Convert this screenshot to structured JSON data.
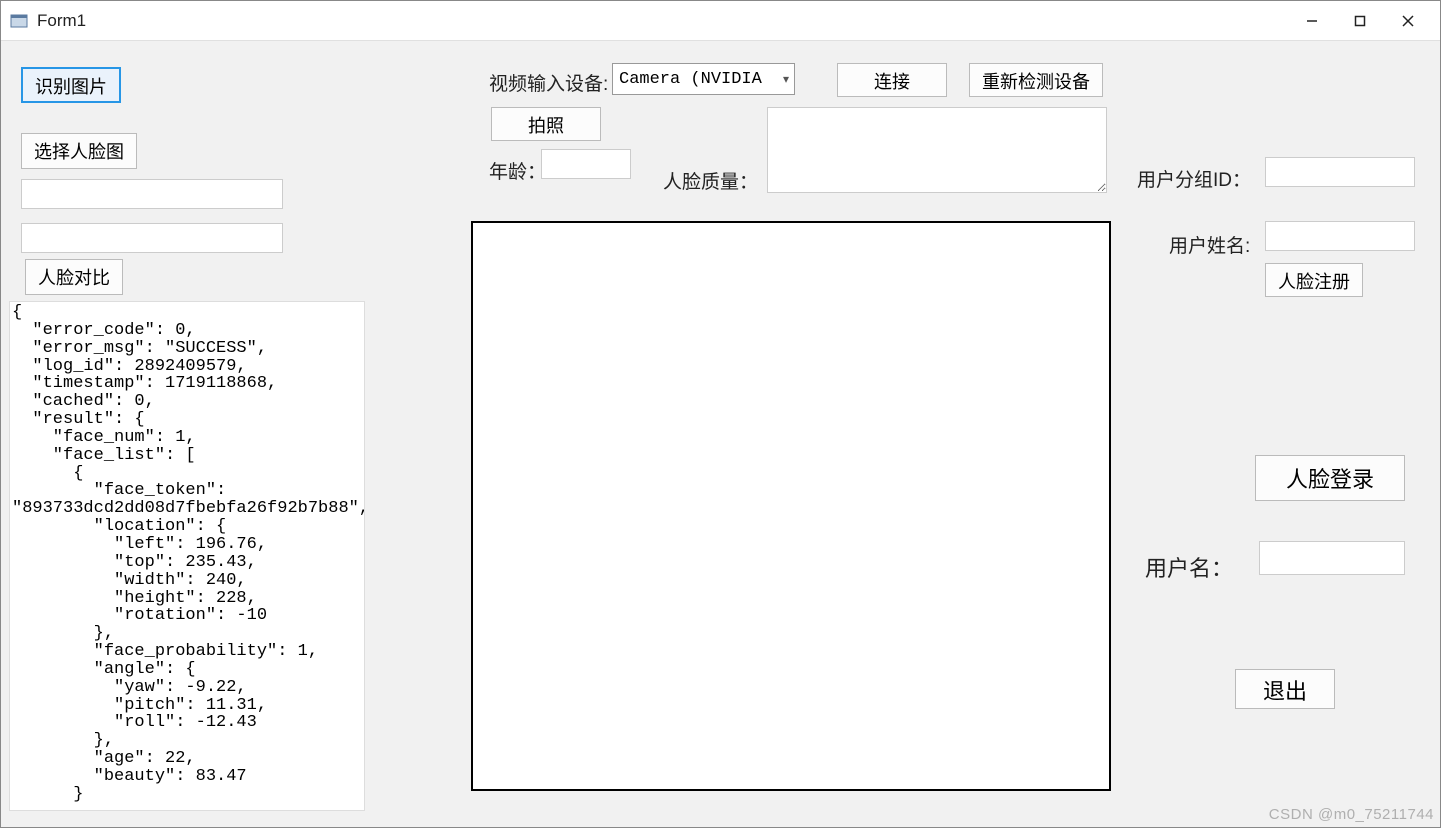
{
  "window": {
    "title": "Form1"
  },
  "titlebar": {
    "minimize_icon": "minimize-icon",
    "maximize_icon": "maximize-icon",
    "close_icon": "close-icon"
  },
  "left": {
    "recognize_btn": "识别图片",
    "choose_face_btn": "选择人脸图",
    "textbox1_value": "",
    "textbox2_value": "",
    "compare_btn": "人脸对比",
    "result_text": "{\n  \"error_code\": 0,\n  \"error_msg\": \"SUCCESS\",\n  \"log_id\": 2892409579,\n  \"timestamp\": 1719118868,\n  \"cached\": 0,\n  \"result\": {\n    \"face_num\": 1,\n    \"face_list\": [\n      {\n        \"face_token\":\n\"893733dcd2dd08d7fbebfa26f92b7b88\",\n        \"location\": {\n          \"left\": 196.76,\n          \"top\": 235.43,\n          \"width\": 240,\n          \"height\": 228,\n          \"rotation\": -10\n        },\n        \"face_probability\": 1,\n        \"angle\": {\n          \"yaw\": -9.22,\n          \"pitch\": 11.31,\n          \"roll\": -12.43\n        },\n        \"age\": 22,\n        \"beauty\": 83.47\n      }"
  },
  "top": {
    "video_label": "视频输入设备:",
    "video_select_value": "Camera (NVIDIA Br",
    "connect_btn": "连接",
    "redetect_btn": "重新检测设备",
    "photo_btn": "拍照",
    "age_label": "年龄：",
    "age_value": "",
    "quality_label": "人脸质量：",
    "quality_value": ""
  },
  "right": {
    "groupid_label": "用户分组ID：",
    "groupid_value": "",
    "username2_label": "用户姓名:",
    "username2_value": "",
    "register_btn": "人脸注册",
    "login_btn": "人脸登录",
    "username_label": "用户名：",
    "username_value": "",
    "exit_btn": "退出"
  },
  "watermark": "CSDN @m0_75211744"
}
